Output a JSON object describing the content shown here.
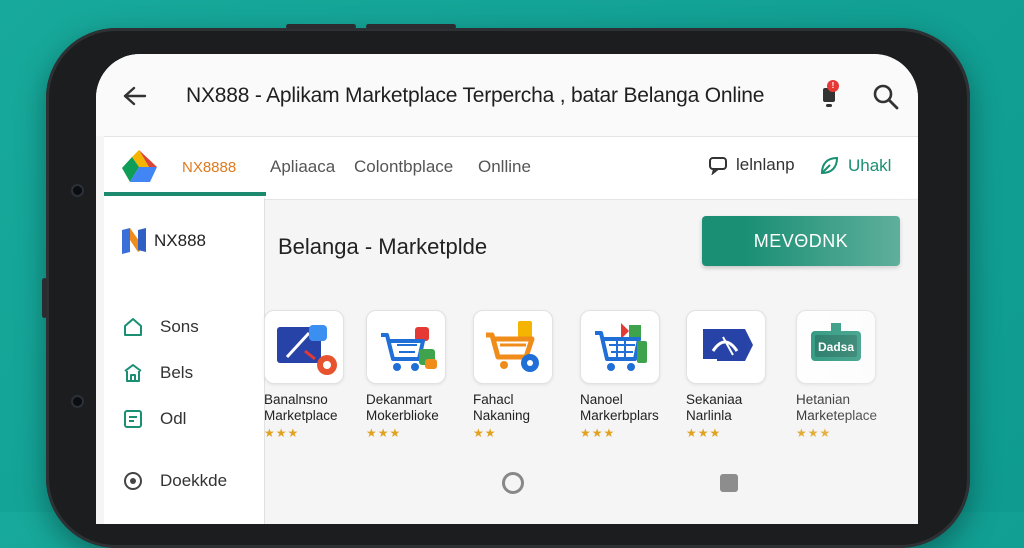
{
  "app_bar": {
    "title": "NX888 - Aplikam Marketplace Terpercha , batar Belanga Online",
    "notification_badge": "!"
  },
  "tab_bar": {
    "tabs": [
      {
        "label": "NX8888",
        "active": true
      },
      {
        "label": "Apliaaca",
        "active": false
      },
      {
        "label": "Colontbplace",
        "active": false
      },
      {
        "label": "Onlline",
        "active": false
      }
    ],
    "right_items": [
      {
        "label": "lelnlanp",
        "icon": "chat-icon"
      },
      {
        "label": "Uhakl",
        "icon": "leaf-icon"
      }
    ]
  },
  "sidebar": {
    "brand": "NX888",
    "items": [
      {
        "label": "Sons",
        "icon": "home-icon"
      },
      {
        "label": "Bels",
        "icon": "shop-icon"
      },
      {
        "label": "Odl",
        "icon": "wallet-icon"
      },
      {
        "label": "Doekkde",
        "icon": "circle-icon"
      }
    ]
  },
  "main": {
    "title": "Belanga - Marketplde",
    "cta_label": "MEVΘDNK"
  },
  "apps": [
    {
      "line1": "Banalnsno",
      "line2": "Marketplace",
      "stars": "★★★"
    },
    {
      "line1": "Dekanmart",
      "line2": "Mokerblioke",
      "stars": "★★★"
    },
    {
      "line1": "Fahacl",
      "line2": "Nakaning",
      "stars": "★★"
    },
    {
      "line1": "Nanoel",
      "line2": "Markerbplars",
      "stars": "★★★"
    },
    {
      "line1": "Sekaniaa",
      "line2": "Narlinla",
      "stars": "★★★"
    },
    {
      "line1": "Hetanian",
      "line2": "Marketeplace",
      "stars": "★★★"
    }
  ],
  "app6_icon_text": "Dadsa",
  "colors": {
    "background": "#12a094",
    "accent": "#1b8f74",
    "tab_active": "#e07a1f",
    "star": "#e2a21f"
  }
}
